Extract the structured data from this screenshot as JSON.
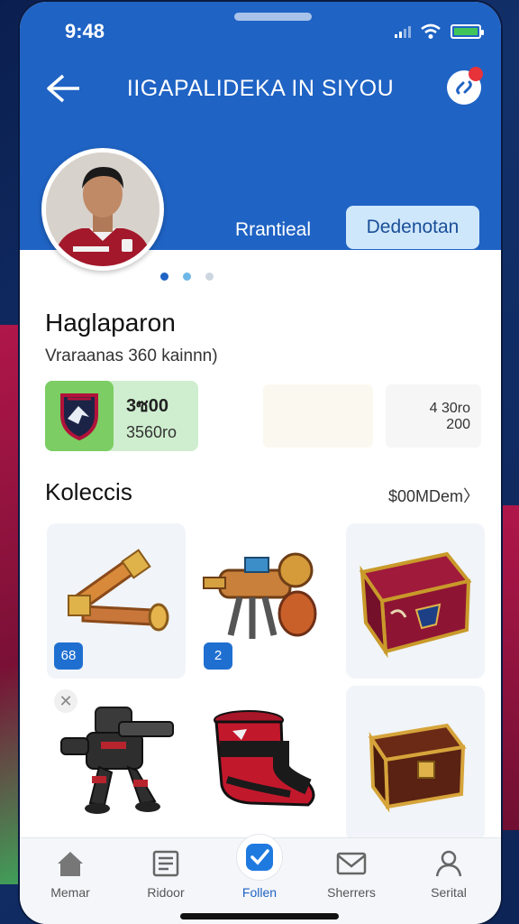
{
  "status": {
    "time": "9:48"
  },
  "header": {
    "title": "IIGAPALIDEKA IN SIYOU"
  },
  "profile": {
    "primary_button": "Rrantieal",
    "secondary_button": "Dedenotan",
    "name": "Haglaparon",
    "subtitle": "Vraraanas 360 kainnn)",
    "stat_value_1": "3ซ00",
    "stat_value_2": "3560ro",
    "stat_right_1": "4 30ro",
    "stat_right_2": "200"
  },
  "collection": {
    "title": "Koleccis",
    "link": "$00MDem〉",
    "badges": [
      "68",
      "2"
    ]
  },
  "tabs": [
    {
      "label": "Memar",
      "icon": "home-icon"
    },
    {
      "label": "Ridoor",
      "icon": "document-icon"
    },
    {
      "label": "Follen",
      "icon": "shield-check-icon"
    },
    {
      "label": "Sherrers",
      "icon": "mail-icon"
    },
    {
      "label": "Serital",
      "icon": "user-icon"
    }
  ],
  "colors": {
    "brand": "#1f63c4",
    "accent_green": "#7ccd63",
    "notification": "#e8323a"
  }
}
